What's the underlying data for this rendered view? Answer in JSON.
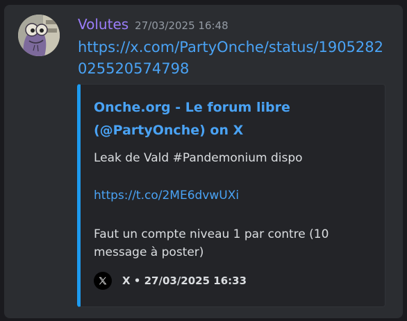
{
  "message": {
    "username": "Volutes",
    "timestamp": "27/03/2025 16:48",
    "link": "https://x.com/PartyOnche/status/1905282025520574798",
    "avatar_icon": "frog-avatar-icon"
  },
  "embed": {
    "accent_color": "#1d9bf0",
    "title": "Onche.org - Le forum libre (@PartyOnche) on X",
    "line1": "Leak de Vald #Pandemonium dispo",
    "link": "https://t.co/2ME6dvwUXi",
    "line3": "Faut un compte niveau 1 par contre (10 message à poster)",
    "footer_icon": "x-logo-icon",
    "footer_text": "X • 27/03/2025 16:33"
  }
}
